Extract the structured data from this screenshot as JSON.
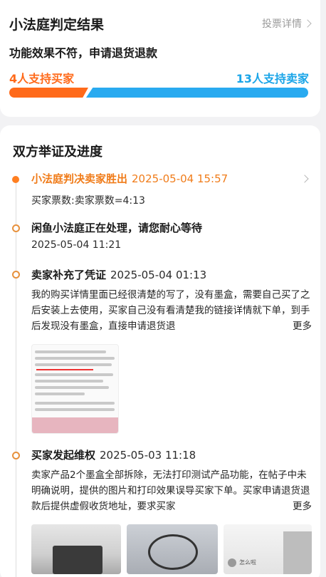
{
  "verdict_card": {
    "title": "小法庭判定结果",
    "detail_link": "投票详情",
    "subtitle": "功能效果不符，申请退货退款",
    "buyer_support": "4人支持买家",
    "seller_support": "13人支持卖家",
    "buyer_votes": 4,
    "seller_votes": 13,
    "buyer_color": "#ff6a1a",
    "seller_color": "#29aaf0"
  },
  "progress": {
    "title": "双方举证及进度",
    "events": [
      {
        "title": "小法庭判决卖家胜出",
        "time": "2025-05-04 15:57",
        "detail": "买家票数:卖家票数=4:13",
        "icon": "chevron-right-icon"
      },
      {
        "title": "闲鱼小法庭正在处理，请您耐心等待",
        "time": "2025-05-04 11:21"
      },
      {
        "title": "卖家补充了凭证",
        "time": "2025-05-04 01:13",
        "body": "我的购买详情里面已经很清楚的写了，没有墨盒，需要自己买了之后安装上去使用，买家自己没有看清楚我的链接详情就下单，到手后发现没有墨盒，直接申请退货退",
        "more": "更多"
      },
      {
        "title": "买家发起维权",
        "time": "2025-05-03 11:18",
        "body": "卖家产品2个墨盒全部拆除，无法打印测试产品功能，在帖子中未明确说明，提供的图片和打印效果误导买家下单。买家申请退货退款后提供虚假收货地址，要求买家",
        "more": "更多"
      }
    ]
  },
  "screenshot_text": {
    "name": "怎么啦"
  }
}
